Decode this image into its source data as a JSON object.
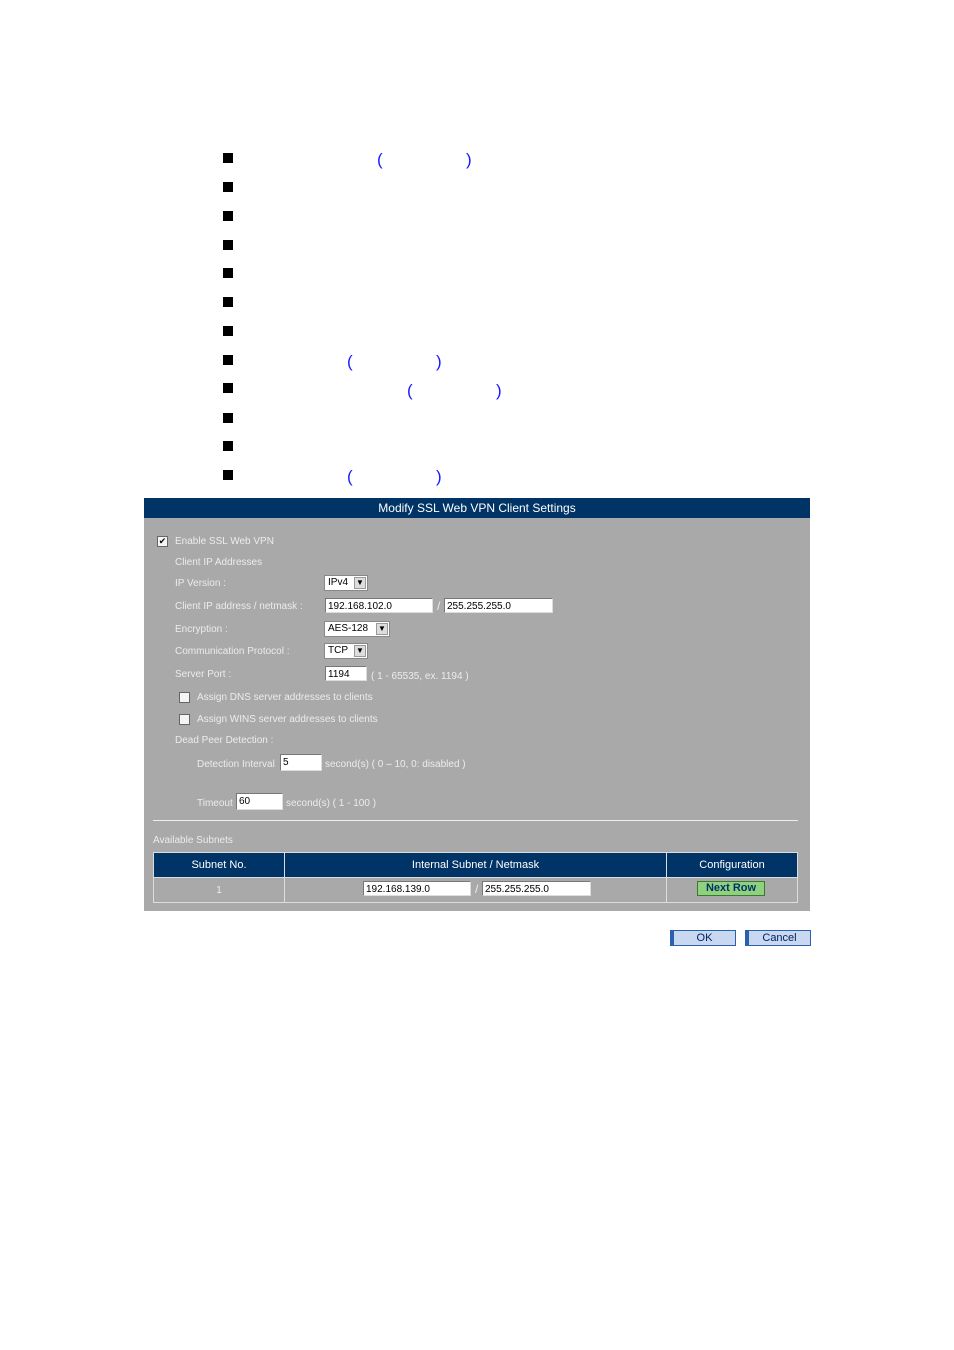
{
  "bullets": {
    "open_paren": "(",
    "close_paren": ")"
  },
  "panel": {
    "title": "Modify SSL Web VPN Client Settings",
    "enable_label": "Enable SSL Web VPN",
    "enable_checked": true,
    "client_ip_heading": "Client IP Addresses",
    "ip_version_label": "IP Version :",
    "ip_version_value": "IPv4",
    "client_ip_label": "Client IP address / netmask :",
    "client_ip_value": "192.168.102.0",
    "slash": "/",
    "client_mask_value": "255.255.255.0",
    "encryption_label": "Encryption :",
    "encryption_value": "AES-128",
    "protocol_label": "Communication Protocol :",
    "protocol_value": "TCP",
    "port_label": "Server Port :",
    "port_value": "1194",
    "port_hint": "( 1 - 65535, ex. 1194 )",
    "dns_label": "Assign DNS server addresses to clients",
    "dns_checked": false,
    "wins_label": "Assign WINS server addresses to clients",
    "wins_checked": false,
    "dpd_label": "Dead Peer Detection :",
    "interval_label": "Detection Interval",
    "interval_value": "5",
    "interval_hint": "second(s)  ( 0 – 10, 0: disabled )",
    "timeout_label": "Timeout",
    "timeout_value": "60",
    "timeout_hint": "second(s)  ( 1 - 100 )",
    "subnets_label": "Available Subnets",
    "columns": [
      "Subnet No.",
      "Internal Subnet / Netmask",
      "Configuration"
    ],
    "rows": [
      {
        "no": "1",
        "subnet": "192.168.139.0",
        "netmask": "255.255.255.0",
        "button": "Next Row"
      }
    ]
  },
  "buttons": {
    "ok": "OK",
    "cancel": "Cancel"
  },
  "colors": {
    "header": "#003366",
    "panel": "#a9a9a9",
    "next_row": "#8fd17f"
  }
}
